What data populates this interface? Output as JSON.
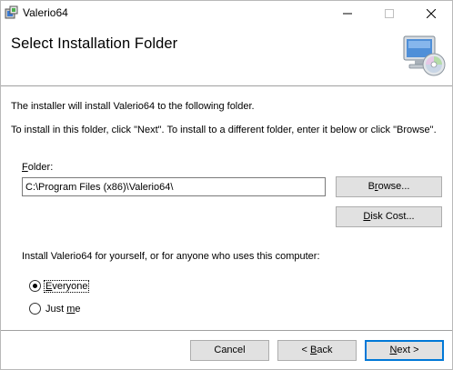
{
  "window": {
    "title": "Valerio64",
    "icons": {
      "app": "installer-package-icon",
      "minimize": "minimize-icon",
      "maximize": "maximize-icon",
      "close": "close-icon"
    }
  },
  "header": {
    "title": "Select Installation Folder",
    "icon": "computer-cd-icon"
  },
  "body": {
    "intro": "The installer will install Valerio64 to the following folder.",
    "instructions": "To install in this folder, click \"Next\". To install to a different folder, enter it below or click \"Browse\".",
    "folder_label_prefix": "F",
    "folder_label_rest": "older:",
    "folder_value": "C:\\Program Files (x86)\\Valerio64\\",
    "browse_prefix": "B",
    "browse_underlined": "r",
    "browse_rest": "owse...",
    "diskcost_prefix": "D",
    "diskcost_rest": "isk Cost...",
    "install_for": "Install Valerio64 for yourself, or for anyone who uses this computer:",
    "radio_everyone_prefix": "E",
    "radio_everyone_rest": "veryone",
    "radio_justme_prefix": "Just ",
    "radio_justme_underlined": "m",
    "radio_justme_rest": "e",
    "selected_option": "Everyone"
  },
  "footer": {
    "cancel": "Cancel",
    "back_prefix": "< ",
    "back_underlined": "B",
    "back_rest": "ack",
    "next_underlined": "N",
    "next_rest": "ext >"
  }
}
